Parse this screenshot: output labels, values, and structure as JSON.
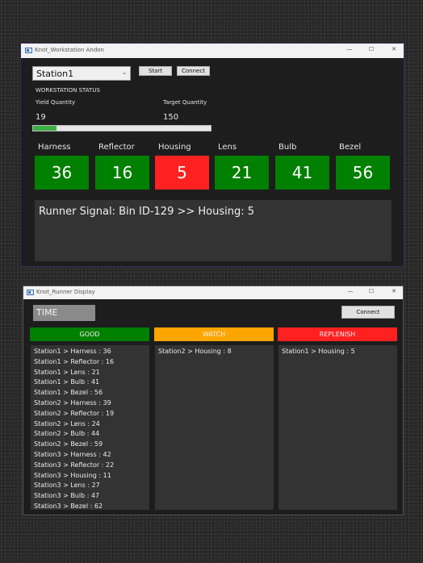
{
  "workstation": {
    "title": "Knot_Workstation Andon",
    "window_controls": [
      "—",
      "☐",
      "✕"
    ],
    "station_select": "Station1",
    "start_label": "Start",
    "connect_label": "Connect",
    "status_heading": "WORKSTATION STATUS",
    "yield_label": "Yield Quantity",
    "yield_value": "19",
    "target_label": "Target Quantity",
    "target_value": "150",
    "progress": 0.13,
    "bins": [
      {
        "name": "Harness",
        "value": "36",
        "status": "good"
      },
      {
        "name": "Reflector",
        "value": "16",
        "status": "good"
      },
      {
        "name": "Housing",
        "value": "5",
        "status": "replenish"
      },
      {
        "name": "Lens",
        "value": "21",
        "status": "good"
      },
      {
        "name": "Bulb",
        "value": "41",
        "status": "good"
      },
      {
        "name": "Bezel",
        "value": "56",
        "status": "good"
      }
    ],
    "runner_signal": "Runner Signal: Bin ID-129 >> Housing: 5"
  },
  "runner": {
    "title": "Knot_Runner Display",
    "window_controls": [
      "—",
      "☐",
      "✕"
    ],
    "time_label": "TIME",
    "connect_label": "Connect",
    "columns": [
      {
        "header": "GOOD",
        "items": [
          "Station1 > Harness : 36",
          "Station1 > Reflector : 16",
          "Station1 > Lens : 21",
          "Station1 > Bulb : 41",
          "Station1 > Bezel : 56",
          "Station2 > Harness : 39",
          "Station2 > Reflector : 19",
          "Station2 > Lens : 24",
          "Station2 > Bulb : 44",
          "Station2 > Bezel : 59",
          "Station3 > Harness : 42",
          "Station3 > Reflector : 22",
          "Station3 > Housing : 11",
          "Station3 > Lens : 27",
          "Station3 > Bulb : 47",
          "Station3 > Bezel : 62"
        ]
      },
      {
        "header": "WATCH",
        "items": [
          "Station2 > Housing : 8"
        ]
      },
      {
        "header": "REPLENISH",
        "items": [
          "Station1 > Housing : 5"
        ]
      }
    ]
  },
  "colors": {
    "good": "#008000",
    "watch": "#ffa500",
    "replenish": "#ff2020",
    "progress_fill": "#3cb043"
  }
}
